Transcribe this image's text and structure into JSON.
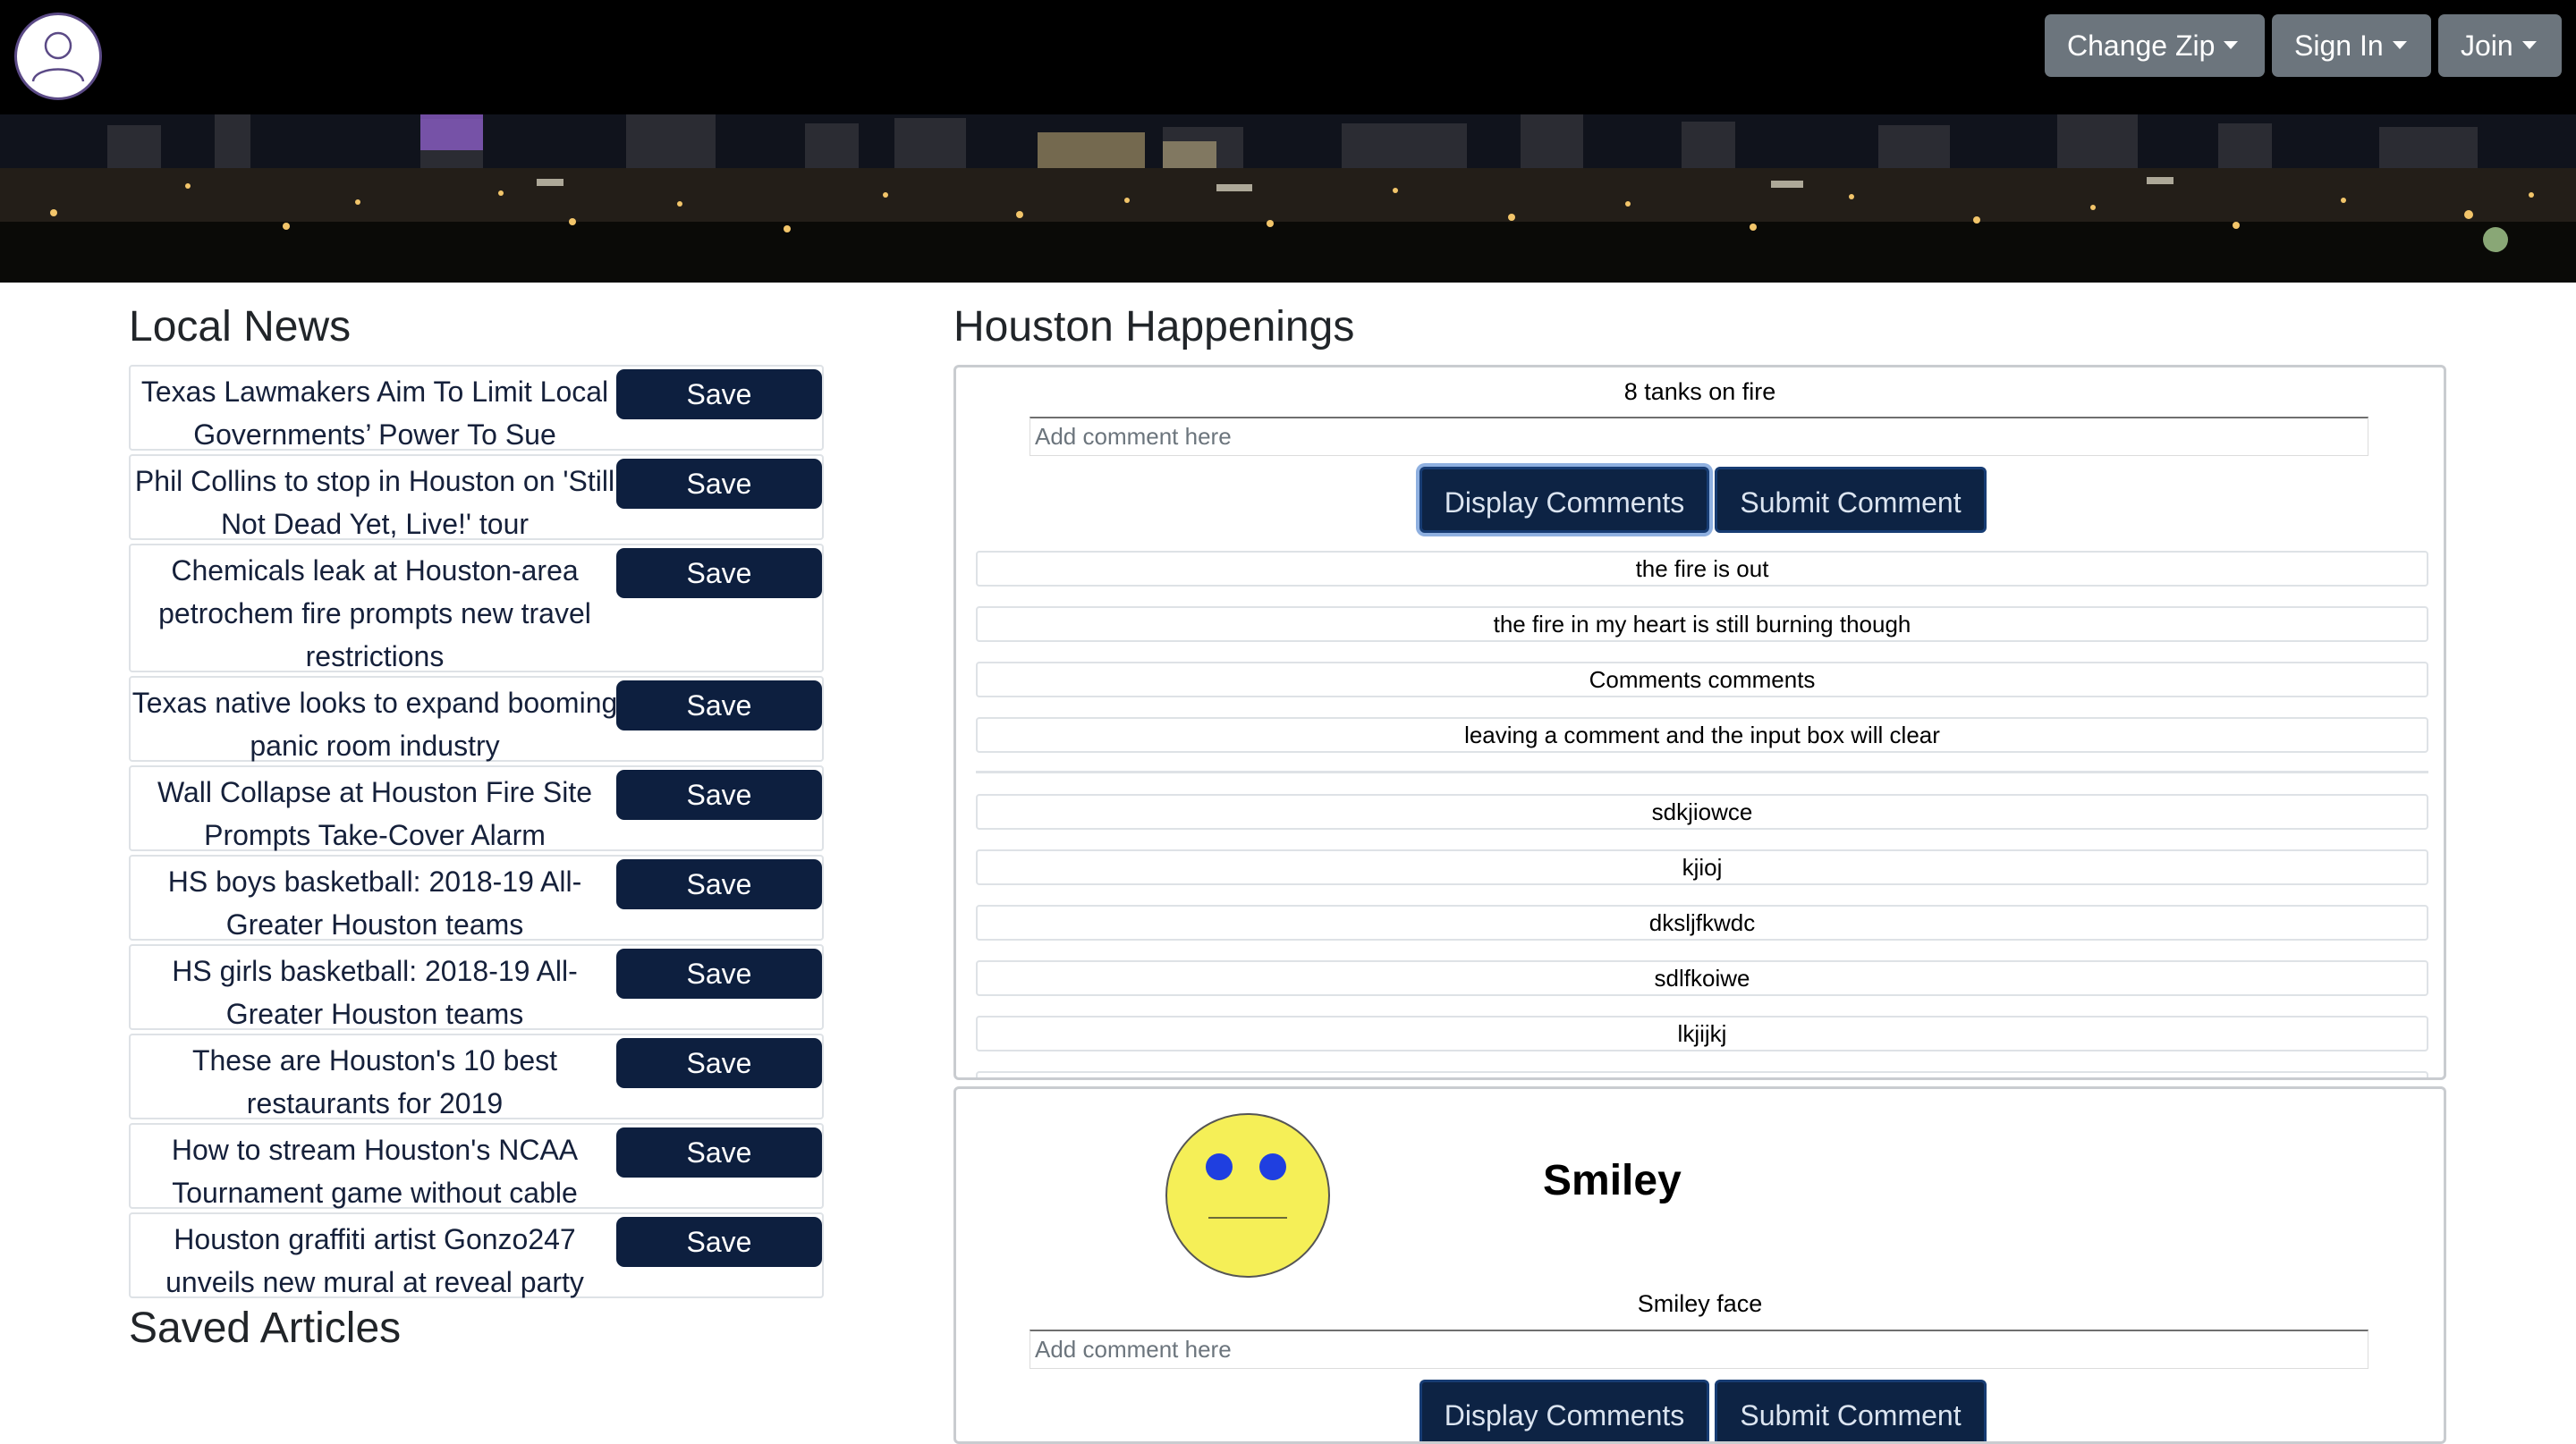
{
  "nav": {
    "change_zip": "Change Zip",
    "sign_in": "Sign In",
    "join": "Join"
  },
  "left": {
    "heading": "Local News",
    "saved_heading": "Saved Articles",
    "articles": [
      {
        "title": "Texas Lawmakers Aim To Limit Local Governments’ Power To Sue",
        "save": "Save"
      },
      {
        "title": "Phil Collins to stop in Houston on 'Still Not Dead Yet, Live!' tour",
        "save": "Save"
      },
      {
        "title": "Chemicals leak at Houston-area petrochem fire prompts new travel restrictions",
        "save": "Save"
      },
      {
        "title": "Texas native looks to expand booming panic room industry",
        "save": "Save"
      },
      {
        "title": "Wall Collapse at Houston Fire Site Prompts Take-Cover Alarm",
        "save": "Save"
      },
      {
        "title": "HS boys basketball: 2018-19 All-Greater Houston teams",
        "save": "Save"
      },
      {
        "title": "HS girls basketball: 2018-19 All-Greater Houston teams",
        "save": "Save"
      },
      {
        "title": "These are Houston's 10 best restaurants for 2019",
        "save": "Save"
      },
      {
        "title": "How to stream Houston's NCAA Tournament game without cable",
        "save": "Save"
      },
      {
        "title": "Houston graffiti artist Gonzo247 unveils new mural at reveal party",
        "save": "Save"
      }
    ]
  },
  "right": {
    "heading": "Houston Happenings",
    "card1": {
      "title": "8 tanks on fire",
      "placeholder": "Add comment here",
      "display_btn": "Display Comments",
      "submit_btn": "Submit Comment",
      "comments": [
        "the fire is out",
        "the fire in my heart is still burning though",
        "Comments comments",
        "leaving a comment and the input box will clear"
      ],
      "comments_more": [
        "sdkjiowce",
        "kjioj",
        "dksljfkwdc",
        "sdlfkoiwe",
        "lkjijkj"
      ]
    },
    "card2": {
      "name": "Smiley",
      "caption": "Smiley face",
      "placeholder": "Add comment here",
      "display_btn": "Display Comments",
      "submit_btn": "Submit Comment",
      "face_color": "#f5ef57",
      "eye_color": "#1f3fe0"
    }
  }
}
